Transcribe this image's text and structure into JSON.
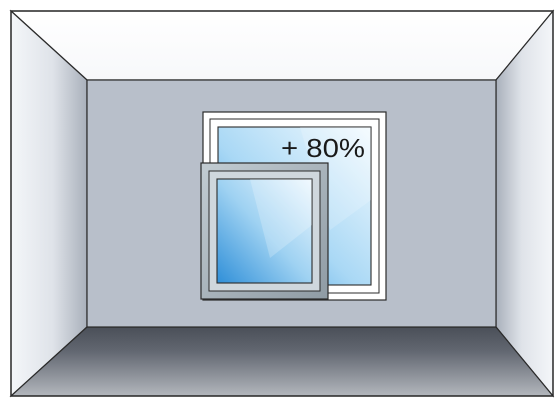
{
  "diagram": {
    "annotation": "+ 80%",
    "colors": {
      "outline": "#2b2b2b",
      "back_wall": "#b8bfca",
      "floor_dark": "#4a4f58",
      "floor_light": "#aeb3ba",
      "side_wall_light": "#f2f4f7",
      "side_wall_dark": "#aab1bc",
      "ceiling": "#ffffff",
      "small_frame": "#9ca8b0",
      "small_frame_inner": "#c9d2d8",
      "glass_light": "#eaf6ff",
      "glass_dark": "#3f9fe0",
      "large_frame": "#ffffff",
      "label_color": "#1a1a1a"
    }
  }
}
